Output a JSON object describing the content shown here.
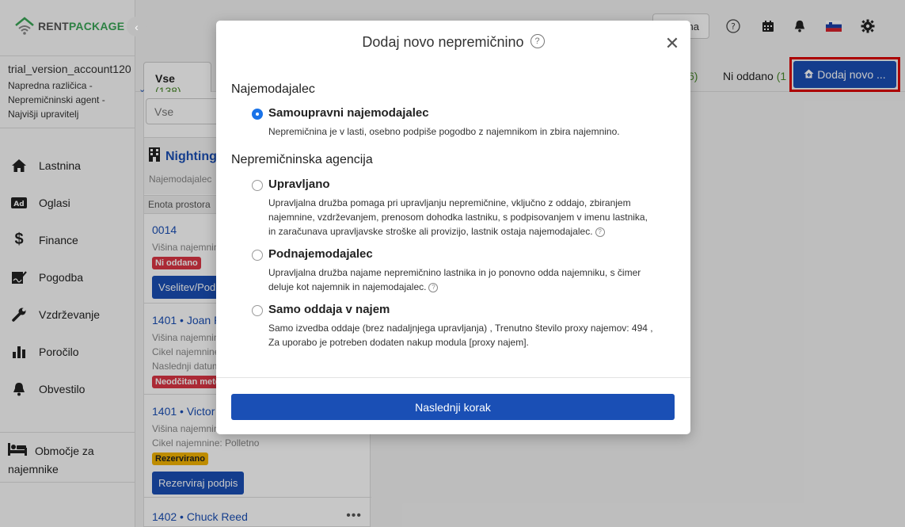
{
  "brand": {
    "rent": "RENT",
    "package": "PACKAGE"
  },
  "account": {
    "name": "trial_version_account120",
    "lines": [
      "Napredna različica -",
      "Nepremičninski agent -",
      "Najvišji upravitelj"
    ]
  },
  "nav": {
    "items": [
      {
        "label": "Lastnina",
        "icon": "home-icon"
      },
      {
        "label": "Oglasi",
        "icon": "ad-icon"
      },
      {
        "label": "Finance",
        "icon": "dollar-icon"
      },
      {
        "label": "Pogodba",
        "icon": "contract-icon"
      },
      {
        "label": "Vzdrževanje",
        "icon": "wrench-icon"
      },
      {
        "label": "Poročilo",
        "icon": "chart-icon"
      },
      {
        "label": "Obvestilo",
        "icon": "bell-icon"
      }
    ],
    "tenant_area": "Območje za najemnike"
  },
  "topbar": {
    "partial_button": "na"
  },
  "tabs": {
    "active_label": "Vse",
    "active_count": "(138)",
    "partial_count": "6)",
    "ni_oddano_label": "Ni oddano",
    "ni_oddano_count": "(1",
    "add_button": "Dodaj novo ..."
  },
  "panel": {
    "search_placeholder": "Vse",
    "property_title": "Nighting",
    "property_sub": "Najemodajalec",
    "unit_header": "Enota prostora",
    "units": [
      {
        "title": "0014",
        "lines": [
          "Višina najemnin"
        ],
        "badge": "Ni oddano",
        "button": "Vselitev/Podp"
      },
      {
        "title": "1401 • Joan R",
        "lines": [
          "Višina najemnin",
          "Cikel najemnine",
          "Naslednji datum"
        ],
        "badge": "Neodčitan mete"
      },
      {
        "title": "1401 • Victor",
        "lines": [
          "Višina najemnin",
          "Cikel najemnine: Polletno"
        ],
        "badge": "Rezervirano",
        "button": "Rezerviraj podpis"
      },
      {
        "title": "1402 • Chuck Reed",
        "lines": []
      }
    ]
  },
  "modal": {
    "title": "Dodaj novo nepremičnino",
    "help": "?",
    "section_landlord": "Najemodajalec",
    "section_agency": "Nepremičninska agencija",
    "options": [
      {
        "label": "Samoupravni najemodajalec",
        "desc": "Nepremičnina je v lasti, osebno podpiše pogodbo z najemnikom in zbira najemnino.",
        "checked": true
      },
      {
        "label": "Upravljano",
        "desc": "Upravljalna družba pomaga pri upravljanju nepremičnine, vključno z oddajo, zbiranjem najemnine, vzdrževanjem, prenosom dohodka lastniku, s podpisovanjem v imenu lastnika, in zaračunava upravljavske stroške ali provizijo, lastnik ostaja najemodajalec.",
        "checked": false
      },
      {
        "label": "Podnajemodajalec",
        "desc": "Upravljalna družba najame nepremičnino lastnika in jo ponovno odda najemniku, s čimer deluje kot najemnik in najemodajalec.",
        "checked": false
      },
      {
        "label": "Samo oddaja v najem",
        "desc": "Samo izvedba oddaje (brez nadaljnjega upravljanja) , Trenutno število proxy najemov: 494 , Za uporabo je potreben dodaten nakup modula [proxy najem].",
        "checked": false
      }
    ],
    "next_button": "Naslednji korak"
  }
}
